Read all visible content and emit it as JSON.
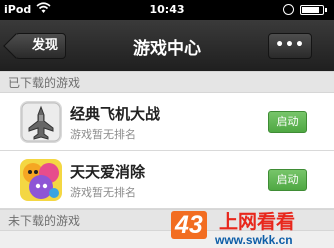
{
  "status_bar": {
    "carrier": "iPod",
    "time": "10:43",
    "battery_level": 0.85
  },
  "nav": {
    "back_label": "发现",
    "title": "游戏中心",
    "more_label": "•••"
  },
  "sections": {
    "downloaded": "已下载的游戏",
    "not_downloaded": "未下载的游戏"
  },
  "games": [
    {
      "name": "经典飞机大战",
      "rank": "游戏暂无排名",
      "action": "启动",
      "icon": "plane-game-icon"
    },
    {
      "name": "天天爱消除",
      "rank": "游戏暂无排名",
      "action": "启动",
      "icon": "cute-creatures-game-icon"
    }
  ],
  "watermark": {
    "number": "43",
    "text": "上网看看",
    "url": "www.swkk.cn"
  },
  "colors": {
    "start_button": "#5cb350",
    "nav_bar": "#2b2b2b"
  }
}
